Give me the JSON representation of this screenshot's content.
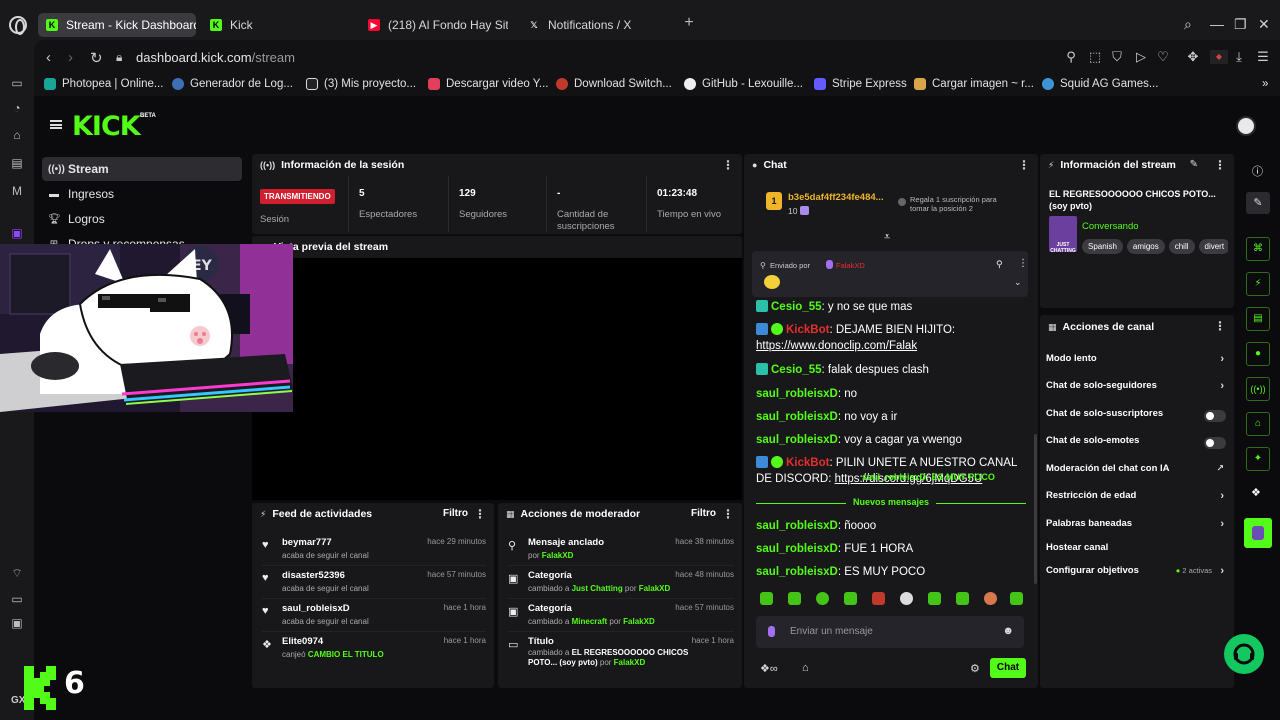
{
  "browser": {
    "tabs": [
      {
        "label": "Stream - Kick Dashboard",
        "active": true
      },
      {
        "label": "Kick",
        "active": false
      },
      {
        "label": "(218) Al Fondo Hay Sitio T",
        "active": false
      },
      {
        "label": "Notifications / X",
        "active": false
      }
    ],
    "url_domain": "dashboard.kick.com",
    "url_path": "/stream",
    "bookmarks": [
      "Photopea | Online...",
      "Generador de Log...",
      "(3)  Mis proyecto...",
      "Descargar video Y...",
      "Download Switch...",
      "GitHub - Lexouille...",
      "Stripe Express",
      "Cargar imagen ~ r...",
      "Squid AG Games..."
    ],
    "side_label": "GX"
  },
  "kick": {
    "logo": "KICK",
    "beta": "BETA",
    "nav": [
      {
        "label": "Stream",
        "icon": "broadcast-icon",
        "active": true
      },
      {
        "label": "Ingresos",
        "icon": "money-icon",
        "active": false
      },
      {
        "label": "Logros",
        "icon": "trophy-icon",
        "active": false
      },
      {
        "label": "Drops y recompensas",
        "icon": "gift-icon",
        "active": false
      }
    ]
  },
  "session": {
    "title": "Información de la sesión",
    "badge": "TRANSMITIENDO",
    "badge_label": "Sesión",
    "stats": [
      {
        "value": "5",
        "label": "Espectadores"
      },
      {
        "value": "129",
        "label": "Seguidores"
      },
      {
        "value": "-",
        "label": "Cantidad de suscripciones"
      },
      {
        "value": "01:23:48",
        "label": "Tiempo en vivo"
      }
    ]
  },
  "preview": {
    "title": "Vista previa del stream"
  },
  "feed": {
    "title": "Feed de actividades",
    "filter": "Filtro",
    "items": [
      {
        "name": "beymar777",
        "sub": "acaba de seguir el canal",
        "time": "hace 29 minutos",
        "icon": "heart-icon"
      },
      {
        "name": "disaster52396",
        "sub": "acaba de seguir el canal",
        "time": "hace 57 minutos",
        "icon": "heart-icon"
      },
      {
        "name": "saul_robleisxD",
        "sub": "acaba de seguir el canal",
        "time": "hace 1 hora",
        "icon": "heart-icon"
      },
      {
        "name": "Elite0974",
        "sub_prefix": "canjeó",
        "sub_highlight": "CAMBIO EL TITULO",
        "time": "hace 1 hora",
        "icon": "reward-icon"
      }
    ]
  },
  "mod": {
    "title": "Acciones de moderador",
    "filter": "Filtro",
    "items": [
      {
        "name": "Mensaje anclado",
        "line": [
          "por ",
          "FalakXD"
        ],
        "time": "hace 38 minutos"
      },
      {
        "name": "Categoría",
        "line": [
          "cambiado a ",
          "Just Chatting",
          " por ",
          "FalakXD"
        ],
        "time": "hace 48 minutos"
      },
      {
        "name": "Categoría",
        "line": [
          "cambiado a ",
          "Minecraft",
          " por ",
          "FalakXD"
        ],
        "time": "hace 57 minutos"
      },
      {
        "name": "Título",
        "line": [
          "cambiado a ",
          "EL REGRESOOOOOO CHICOS POTO... (soy pvto)",
          " por ",
          "FalakXD"
        ],
        "time": "hace 1 hora"
      }
    ]
  },
  "chat": {
    "title": "Chat",
    "gift_user": "b3e5daf4ff234fe484...",
    "gift_count": "10",
    "gift_rank": "1",
    "gift_note": "Regala 1 suscripción para tomar la posición 2",
    "pinned_by_label": "Enviado por",
    "pinned_by": "FalakXD",
    "messages": [
      {
        "user": "Cesio_55",
        "text": ": y no se que mas",
        "kind": "user"
      },
      {
        "user": "KickBot",
        "text": ": DEJAME BIEN HIJITO:",
        "link": "https://www.donoclip.com/Falak",
        "kind": "bot"
      },
      {
        "user": "Cesio_55",
        "text": ": falak despues clash",
        "kind": "user"
      },
      {
        "user": "saul_robleisxD",
        "text": ": no",
        "kind": "user"
      },
      {
        "user": "saul_robleisxD",
        "text": ": no voy a ir",
        "kind": "user"
      },
      {
        "user": "saul_robleisxD",
        "text": ": voy a cagar ya vwengo",
        "kind": "user"
      },
      {
        "user": "KickBot",
        "text": ": PILIN UNETE A NUESTRO CANAL DE DISCORD:",
        "link": "https://discord.gg/6jMqDG5U",
        "kind": "bot"
      },
      {
        "user": "saul_robleisxD",
        "text": ": ñoooo",
        "kind": "user"
      },
      {
        "user": "saul_robleisxD",
        "text": ": FUE 1 HORA",
        "kind": "user"
      },
      {
        "user": "saul_robleisxD",
        "text": ": ES MUY POCO",
        "kind": "user"
      }
    ],
    "overlap_text": "saul_robleisxD: ES MUY POCO",
    "new_messages": "Nuevos mensajes",
    "placeholder": "Enviar un mensaje",
    "send": "Chat"
  },
  "stream_info": {
    "title": "Información del stream",
    "stream_title": "EL REGRESOOOOOO CHICOS POTO... (soy pvto)",
    "category": "Conversando",
    "category_thumb": "JUST CHATTING",
    "tags": [
      "Spanish",
      "amigos",
      "chill",
      "divert"
    ]
  },
  "actions": {
    "title": "Acciones de canal",
    "items": [
      {
        "label": "Modo lento",
        "control": "chevron"
      },
      {
        "label": "Chat de solo-seguidores",
        "control": "chevron"
      },
      {
        "label": "Chat de solo-suscriptores",
        "control": "toggle"
      },
      {
        "label": "Chat de solo-emotes",
        "control": "toggle"
      },
      {
        "label": "Moderación del chat con IA",
        "control": "external"
      },
      {
        "label": "Restricción de edad",
        "control": "chevron"
      },
      {
        "label": "Palabras baneadas",
        "control": "chevron"
      },
      {
        "label": "Hostear canal",
        "control": "none"
      },
      {
        "label": "Configurar objetivos",
        "control": "chevron",
        "note": "2 activas"
      }
    ]
  },
  "overlay": {
    "number": "6"
  },
  "colors": {
    "kick_green": "#53fc18",
    "bg": "#0b0b0d",
    "panel": "#18181b",
    "live_red": "#d11f2f",
    "kickbot_red": "#e62e2e"
  }
}
